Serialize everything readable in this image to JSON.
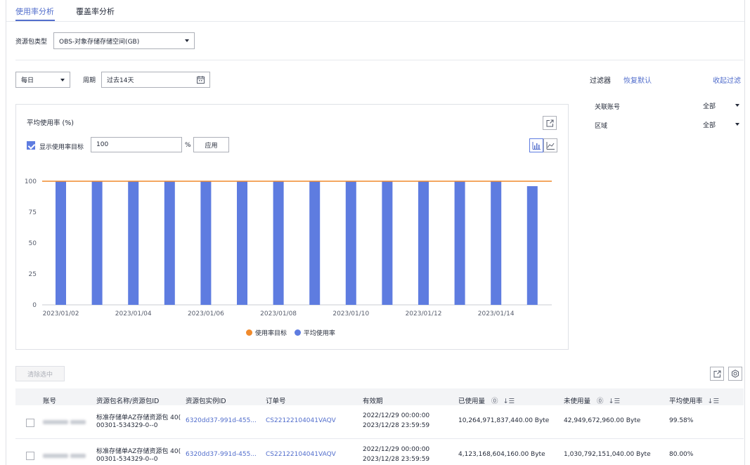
{
  "tabs": [
    {
      "label": "使用率分析"
    },
    {
      "label": "覆盖率分析"
    }
  ],
  "package_type": {
    "label": "资源包类型",
    "value": "OBS-对象存储存储空间(GB)"
  },
  "granularity": {
    "value": "每日"
  },
  "period": {
    "label": "周期",
    "value": "过去14天"
  },
  "filter": {
    "title": "过滤器",
    "reset": "恢复默认",
    "collapse": "收起过滤",
    "items": [
      {
        "label": "关联账号",
        "value": "全部"
      },
      {
        "label": "区域",
        "value": "全部"
      }
    ]
  },
  "chart_panel": {
    "title": "平均使用率 (%)",
    "show_target_label": "显示使用率目标",
    "target_value": "100",
    "percent_unit": "%",
    "apply_label": "应用"
  },
  "chart_data": {
    "type": "bar",
    "ylim": [
      0,
      100
    ],
    "yticks": [
      "0",
      "25",
      "50",
      "75",
      "100"
    ],
    "categories": [
      "2023/01/02",
      "2023/01/03",
      "2023/01/04",
      "2023/01/05",
      "2023/01/06",
      "2023/01/07",
      "2023/01/08",
      "2023/01/09",
      "2023/01/10",
      "2023/01/11",
      "2023/01/12",
      "2023/01/13",
      "2023/01/14",
      "2023/01/15"
    ],
    "xtick_labels": [
      "2023/01/02",
      "2023/01/04",
      "2023/01/06",
      "2023/01/08",
      "2023/01/10",
      "2023/01/12",
      "2023/01/14"
    ],
    "series": [
      {
        "name": "平均使用率",
        "color": "#5e7ce0",
        "values": [
          100,
          100,
          100,
          100,
          100,
          100,
          100,
          100,
          100,
          100,
          100,
          100,
          100,
          96
        ]
      },
      {
        "name": "使用率目标",
        "color": "#f08a2c",
        "type": "line",
        "values": [
          100,
          100,
          100,
          100,
          100,
          100,
          100,
          100,
          100,
          100,
          100,
          100,
          100,
          100
        ]
      }
    ],
    "legend": "bottom"
  },
  "table": {
    "clear_selection": "清除选中",
    "columns": [
      "账号",
      "资源包名称/资源包ID",
      "资源包实例ID",
      "订单号",
      "有效期",
      "已使用量",
      "未使用量",
      "平均使用率"
    ],
    "rows": [
      {
        "name": "标准存储单AZ存储资源包 40(",
        "package_id": "00301-534329-0--0",
        "instance_id": "6320dd37-991d-455...",
        "order_id": "CS22122104041VAQV",
        "valid_from": "2022/12/29 00:00:00",
        "valid_to": "2023/12/28 23:59:59",
        "used": "10,264,971,837,440.00 Byte",
        "unused": "42,949,672,960.00 Byte",
        "avg_rate": "99.58%"
      },
      {
        "name": "标准存储单AZ存储资源包 40(",
        "package_id": "00301-534329-0--0",
        "instance_id": "6320dd37-991d-455...",
        "order_id": "CS22122104041VAQV",
        "valid_from": "2022/12/29 00:00:00",
        "valid_to": "2023/12/28 23:59:59",
        "used": "4,123,168,604,160.00 Byte",
        "unused": "1,030,792,151,040.00 Byte",
        "avg_rate": "80.00%"
      }
    ]
  },
  "colors": {
    "accent": "#526ecc",
    "bar": "#5e7ce0",
    "target_line": "#f08a2c"
  }
}
